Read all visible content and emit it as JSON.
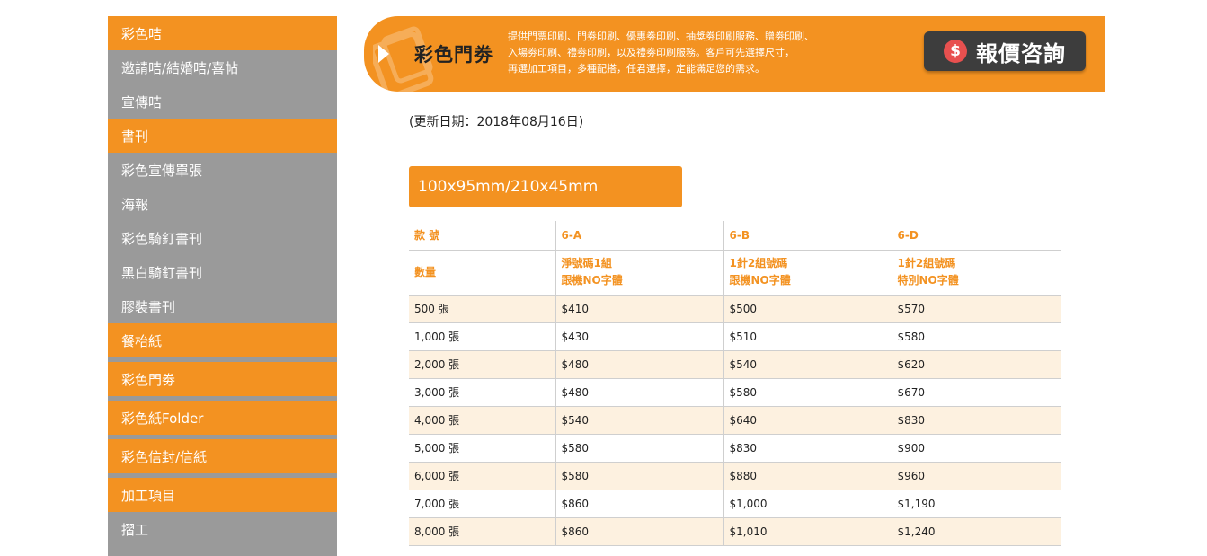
{
  "sidebar": {
    "items": [
      {
        "label": "彩色咭",
        "kind": "cat"
      },
      {
        "label": "邀請咭/結婚咭/喜帖",
        "kind": "sub"
      },
      {
        "label": "宣傳咭",
        "kind": "sub"
      },
      {
        "label": "書刊",
        "kind": "cat"
      },
      {
        "label": "彩色宣傳單張",
        "kind": "sub"
      },
      {
        "label": "海報",
        "kind": "sub"
      },
      {
        "label": "彩色騎釘書刊",
        "kind": "sub"
      },
      {
        "label": "黑白騎釘書刊",
        "kind": "sub"
      },
      {
        "label": "膠裝書刊",
        "kind": "sub"
      },
      {
        "label": "餐枱紙",
        "kind": "cat"
      },
      {
        "label": "彩色門劵",
        "kind": "cat"
      },
      {
        "label": "彩色紙Folder",
        "kind": "cat"
      },
      {
        "label": "彩色信封/信紙",
        "kind": "cat"
      },
      {
        "label": "加工項目",
        "kind": "cat"
      },
      {
        "label": "摺工",
        "kind": "sub"
      }
    ]
  },
  "banner": {
    "title": "彩色門劵",
    "desc_line1": "提供門票印刷、門劵印刷、優惠劵印刷、抽獎劵印刷服務、贈劵印刷、",
    "desc_line2": "入場劵印刷、禮劵印刷，以及禮劵印刷服務。客戶可先選擇尺寸，",
    "desc_line3": "再選加工項目，多種配搭，任君選擇，定能滿足您的需求。",
    "quote_icon": "$",
    "quote_label": "報價咨詢"
  },
  "update_date": "(更新日期：2018年08月16日)",
  "size_tag": "100x95mm/210x45mm",
  "table": {
    "head1": [
      "款 號",
      "6-A",
      "6-B",
      "6-D"
    ],
    "head2": [
      {
        "l1": "數量",
        "l2": ""
      },
      {
        "l1": "淨號碼1組",
        "l2": "跟機NO字體"
      },
      {
        "l1": "1針2組號碼",
        "l2": "跟機NO字體"
      },
      {
        "l1": "1針2組號碼",
        "l2": "特別NO字體"
      }
    ],
    "rows": [
      [
        "500 張",
        "$410",
        "$500",
        "$570"
      ],
      [
        "1,000 張",
        "$430",
        "$510",
        "$580"
      ],
      [
        "2,000 張",
        "$480",
        "$540",
        "$620"
      ],
      [
        "3,000 張",
        "$480",
        "$580",
        "$670"
      ],
      [
        "4,000 張",
        "$540",
        "$640",
        "$830"
      ],
      [
        "5,000 張",
        "$580",
        "$830",
        "$900"
      ],
      [
        "6,000 張",
        "$580",
        "$880",
        "$960"
      ],
      [
        "7,000 張",
        "$860",
        "$1,000",
        "$1,190"
      ],
      [
        "8,000 張",
        "$860",
        "$1,010",
        "$1,240"
      ]
    ]
  }
}
